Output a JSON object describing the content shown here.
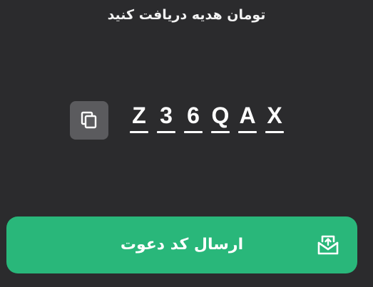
{
  "subtitle": "تومان هدیه دریافت کنید",
  "invite_code": {
    "characters": [
      "Z",
      "3",
      "6",
      "Q",
      "A",
      "X"
    ]
  },
  "icons": {
    "copy": "copy-icon",
    "share": "share-envelope-icon"
  },
  "send_button": {
    "label": "ارسال کد دعوت"
  },
  "colors": {
    "background": "#2b2b2d",
    "accent": "#29b77a",
    "copy_button_bg": "#5b5b5e"
  }
}
